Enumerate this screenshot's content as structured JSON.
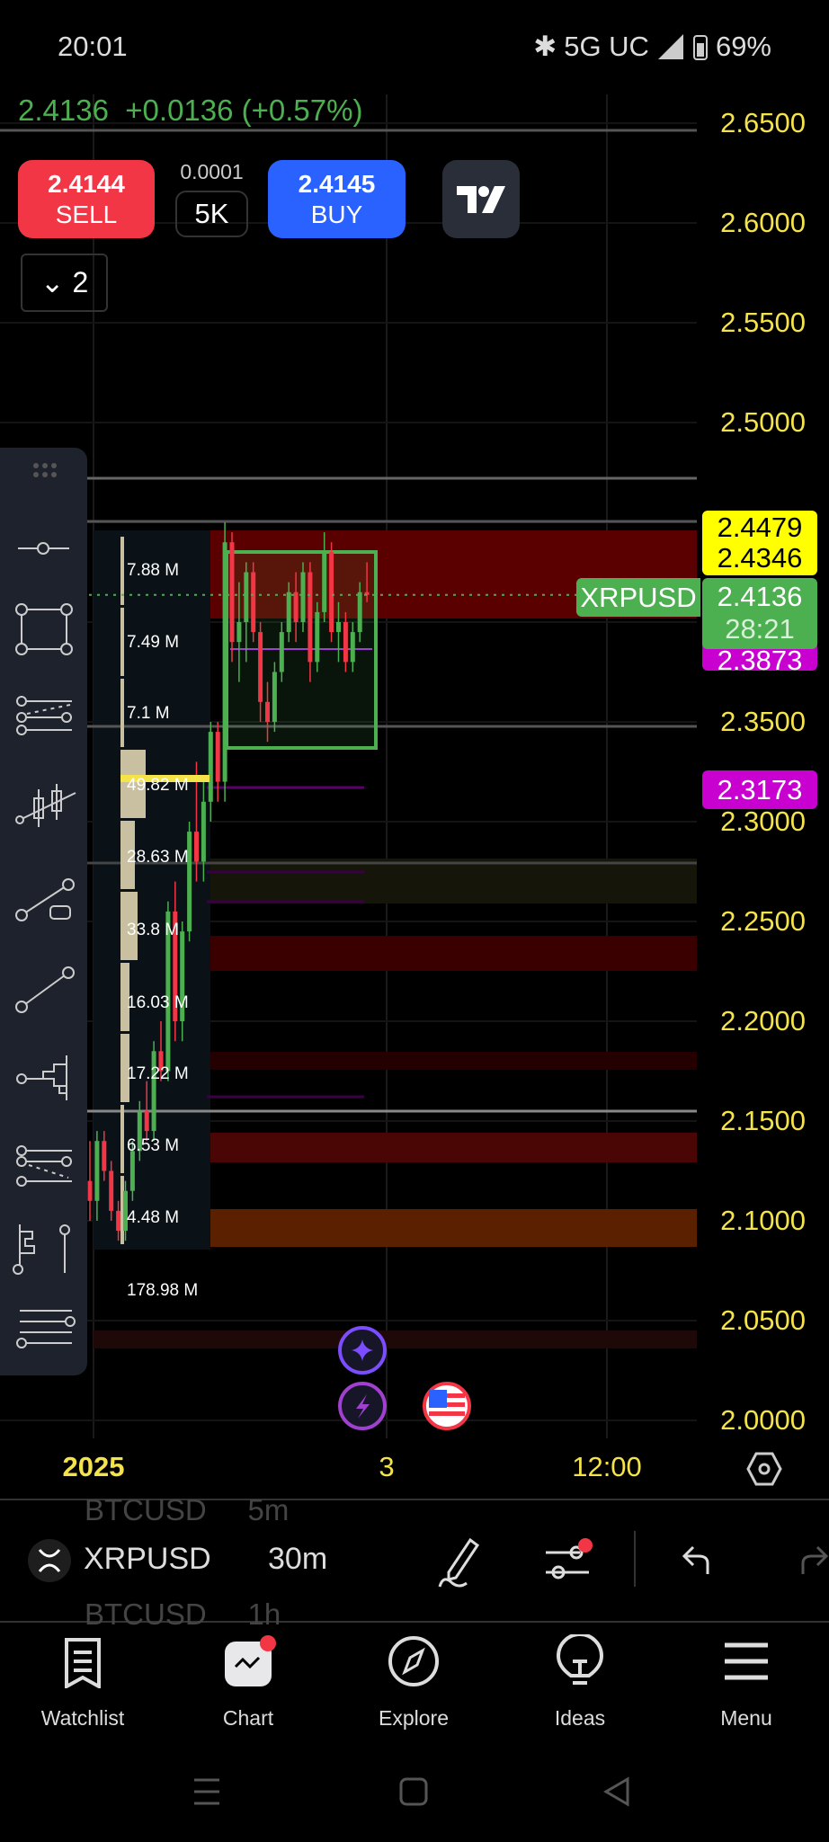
{
  "status_bar": {
    "time": "20:01",
    "network": "5G UC",
    "battery": "69%"
  },
  "quote": {
    "last": "2.4136",
    "change": "+0.0136 (+0.57%)"
  },
  "trade": {
    "sell_price": "2.4144",
    "sell_label": "SELL",
    "buy_price": "2.4145",
    "buy_label": "BUY",
    "step": "0.0001",
    "quantity": "5K"
  },
  "layers": {
    "count": "2"
  },
  "price_axis": [
    "2.6500",
    "2.6000",
    "2.5500",
    "2.5000",
    "2.3500",
    "2.3000",
    "2.2500",
    "2.2000",
    "2.1500",
    "2.1000",
    "2.0500",
    "2.0000"
  ],
  "price_tags": {
    "yellow_top": "2.4479",
    "yellow_bottom": "2.4346",
    "symbol": "XRPUSD",
    "last": "2.4136",
    "countdown": "28:21",
    "magenta_hidden": "2.3873",
    "magenta": "2.3173"
  },
  "volume_profile": [
    "7.88 M",
    "7.49 M",
    "7.1 M",
    "49.82 M",
    "28.63 M",
    "33.8 M",
    "16.03 M",
    "17.22 M",
    "6.53 M",
    "4.48 M",
    "178.98 M"
  ],
  "time_axis": {
    "year": "2025",
    "day": "3",
    "time": "12:00"
  },
  "symbol_bar": {
    "symbol": "XRPUSD",
    "interval": "30m",
    "prev_symbol": "BTCUSD",
    "prev_interval": "5m",
    "next_symbol": "BTCUSD",
    "next_interval": "1h"
  },
  "nav": [
    {
      "label": "Watchlist"
    },
    {
      "label": "Chart"
    },
    {
      "label": "Explore"
    },
    {
      "label": "Ideas"
    },
    {
      "label": "Menu"
    }
  ],
  "colors": {
    "up": "#4caf50",
    "down": "#f23645",
    "axis": "#f5e34a",
    "sell": "#f23645",
    "buy": "#2962ff",
    "magenta": "#c800d0"
  },
  "chart_data": {
    "type": "candlestick",
    "ylim": [
      2.0,
      2.65
    ],
    "candles": [
      [
        2.12,
        2.14,
        2.1,
        2.11
      ],
      [
        2.11,
        2.145,
        2.1,
        2.14
      ],
      [
        2.14,
        2.145,
        2.12,
        2.125
      ],
      [
        2.125,
        2.13,
        2.1,
        2.105
      ],
      [
        2.105,
        2.11,
        2.09,
        2.095
      ],
      [
        2.095,
        2.12,
        2.09,
        2.115
      ],
      [
        2.115,
        2.14,
        2.11,
        2.135
      ],
      [
        2.135,
        2.16,
        2.13,
        2.155
      ],
      [
        2.155,
        2.17,
        2.14,
        2.145
      ],
      [
        2.145,
        2.19,
        2.14,
        2.185
      ],
      [
        2.185,
        2.2,
        2.17,
        2.175
      ],
      [
        2.175,
        2.26,
        2.17,
        2.255
      ],
      [
        2.255,
        2.27,
        2.19,
        2.2
      ],
      [
        2.2,
        2.25,
        2.19,
        2.245
      ],
      [
        2.245,
        2.3,
        2.24,
        2.295
      ],
      [
        2.295,
        2.33,
        2.27,
        2.28
      ],
      [
        2.28,
        2.32,
        2.27,
        2.31
      ],
      [
        2.31,
        2.35,
        2.3,
        2.345
      ],
      [
        2.345,
        2.35,
        2.31,
        2.32
      ],
      [
        2.32,
        2.45,
        2.31,
        2.44
      ],
      [
        2.44,
        2.445,
        2.38,
        2.39
      ],
      [
        2.39,
        2.42,
        2.37,
        2.4
      ],
      [
        2.4,
        2.43,
        2.38,
        2.425
      ],
      [
        2.425,
        2.43,
        2.39,
        2.395
      ],
      [
        2.395,
        2.4,
        2.35,
        2.36
      ],
      [
        2.36,
        2.37,
        2.34,
        2.35
      ],
      [
        2.35,
        2.38,
        2.345,
        2.375
      ],
      [
        2.375,
        2.4,
        2.37,
        2.395
      ],
      [
        2.395,
        2.42,
        2.39,
        2.415
      ],
      [
        2.415,
        2.425,
        2.39,
        2.4
      ],
      [
        2.4,
        2.43,
        2.395,
        2.425
      ],
      [
        2.425,
        2.43,
        2.37,
        2.38
      ],
      [
        2.38,
        2.41,
        2.375,
        2.405
      ],
      [
        2.405,
        2.445,
        2.4,
        2.435
      ],
      [
        2.435,
        2.44,
        2.39,
        2.395
      ],
      [
        2.395,
        2.41,
        2.38,
        2.4
      ],
      [
        2.4,
        2.405,
        2.375,
        2.38
      ],
      [
        2.38,
        2.4,
        2.375,
        2.395
      ],
      [
        2.395,
        2.42,
        2.39,
        2.415
      ],
      [
        2.415,
        2.43,
        2.41,
        2.4136
      ]
    ]
  }
}
